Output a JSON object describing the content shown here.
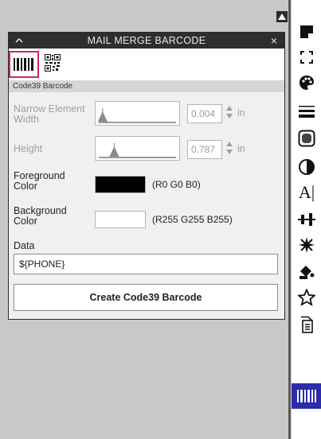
{
  "panel": {
    "title": "MAIL MERGE BARCODE",
    "close_glyph": "×",
    "subtitle": "Code39 Barcode",
    "barcode_types": [
      {
        "name": "linear-barcode",
        "icon": "barcode-icon",
        "selected": true
      },
      {
        "name": "qr-code",
        "icon": "qr-code-icon",
        "selected": false
      }
    ]
  },
  "fields": {
    "narrow": {
      "label": "Narrow Element Width",
      "value": "0.004",
      "unit": "in",
      "slider_fraction": 0.05
    },
    "height": {
      "label": "Height",
      "value": "0.787",
      "unit": "in",
      "slider_fraction": 0.2
    },
    "foreground": {
      "label": "Foreground Color",
      "rgb": "(R0 G0 B0)",
      "color": "#000000"
    },
    "background": {
      "label": "Background Color",
      "rgb": "(R255 G255 B255)",
      "color": "#ffffff"
    },
    "data": {
      "label": "Data",
      "value": "${PHONE}"
    }
  },
  "create_button": {
    "label": "Create Code39 Barcode"
  },
  "toolbar": {
    "items": [
      "sticky-note-icon",
      "crop-icon",
      "palette-icon",
      "lines-icon",
      "rounded-square-icon",
      "contrast-icon",
      "text-cursor-icon",
      "align-icon",
      "sparkle-icon",
      "paint-bucket-icon",
      "star-icon",
      "document-icon",
      "barcode-icon"
    ],
    "active": "barcode-icon",
    "text_glyph": "A|"
  },
  "colors": {
    "accent": "#2b2ca8",
    "selection": "#d2246a",
    "titlebar": "#2e2e2e"
  }
}
